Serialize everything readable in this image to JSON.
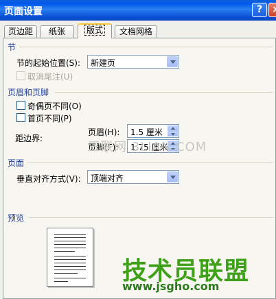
{
  "window": {
    "title": "页面设置",
    "help_label": "?",
    "close_label": "×"
  },
  "tabs": [
    {
      "label": "页边距"
    },
    {
      "label": "纸张"
    },
    {
      "label": "版式"
    },
    {
      "label": "文档网格"
    }
  ],
  "section_jie": {
    "heading": "节",
    "start_label": "节的起始位置(S):",
    "start_value": "新建页",
    "suppress_endnotes_label": "取消尾注(U)"
  },
  "section_header_footer": {
    "heading": "页眉和页脚",
    "odd_even_label": "奇偶页不同(O)",
    "first_page_label": "首页不同(P)",
    "from_edge_label": "距边界:",
    "header_label": "页眉(H):",
    "header_value": "1.5 厘米",
    "footer_label": "页脚(F):",
    "footer_value": "1.75 厘米"
  },
  "section_page": {
    "heading": "页面",
    "vertical_align_label": "垂直对齐方式(V):",
    "vertical_align_value": "顶端对齐"
  },
  "preview": {
    "heading": "预览"
  },
  "watermark": {
    "overlay_text": "三联网 3LIAN.COM",
    "logo_text": "技术员联盟",
    "logo_url": "www.jsgho.com"
  }
}
